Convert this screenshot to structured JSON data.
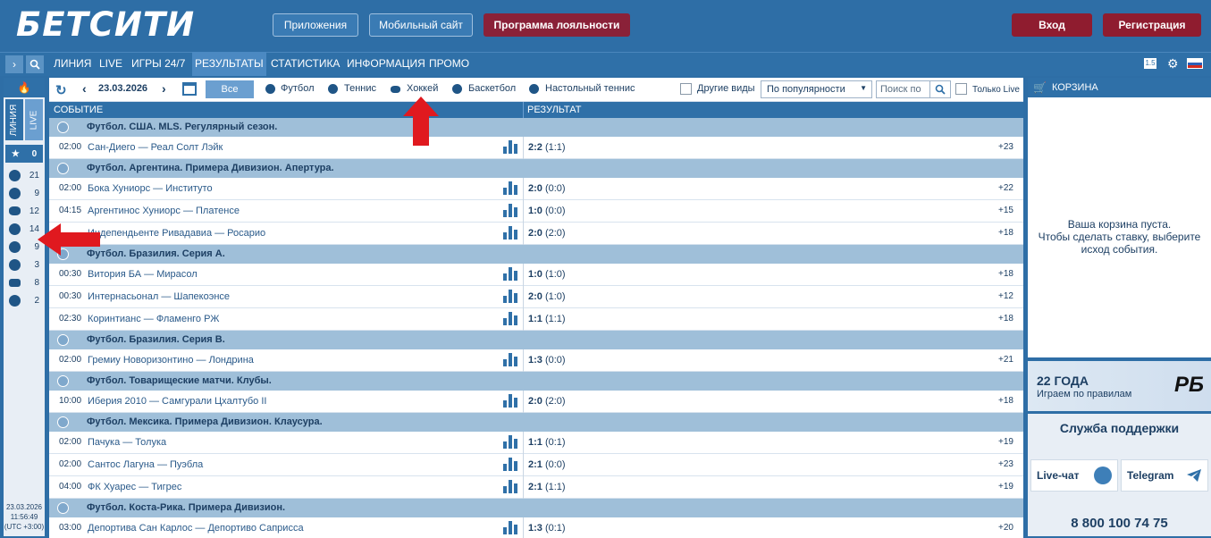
{
  "header": {
    "logo": "БЕТСИТИ",
    "apps_label": "Приложения",
    "mobile_label": "Мобильный сайт",
    "loyalty_label": "Программа лояльности",
    "login_label": "Вход",
    "register_label": "Регистрация"
  },
  "nav": {
    "items": [
      "ЛИНИЯ",
      "LIVE",
      "ИГРЫ 24/7",
      "РЕЗУЛЬТАТЫ",
      "СТАТИСТИКА",
      "ИНФОРМАЦИЯ",
      "ПРОМО"
    ],
    "badge": "1.5"
  },
  "sidebar": {
    "tabs": [
      "ЛИНИЯ",
      "LIVE"
    ],
    "favorites_count": "0",
    "sports": [
      {
        "icon": "soccer-ball-icon",
        "count": "21"
      },
      {
        "icon": "tennis-ball-icon",
        "count": "9"
      },
      {
        "icon": "hockey-puck-icon",
        "count": "12"
      },
      {
        "icon": "basketball-icon",
        "count": "14"
      },
      {
        "icon": "table-tennis-icon",
        "count": "9"
      },
      {
        "icon": "volleyball-icon",
        "count": "3"
      },
      {
        "icon": "gamepad-icon",
        "count": "8"
      },
      {
        "icon": "ball-icon",
        "count": "2"
      }
    ],
    "date": "23.03.2026",
    "time": "11:56:49",
    "tz": "(UTC +3:00)"
  },
  "toolbar": {
    "date": "23.03.2026",
    "all_label": "Все",
    "filters": [
      "Футбол",
      "Теннис",
      "Хоккей",
      "Баскетбол",
      "Настольный теннис"
    ],
    "other_label": "Другие виды",
    "sort_value": "По популярности",
    "search_placeholder": "Поиск по",
    "live_only_label": "Только Live"
  },
  "columns": {
    "event": "СОБЫТИЕ",
    "result": "РЕЗУЛЬТАТ"
  },
  "leagues": [
    {
      "name": "Футбол. США. MLS. Регулярный сезон.",
      "matches": [
        {
          "time": "02:00",
          "teams": "Сан-Диего — Реал Солт Лэйк",
          "score": "2:2",
          "half": "(1:1)",
          "more": "+23"
        }
      ]
    },
    {
      "name": "Футбол. Аргентина. Примера Дивизион. Апертура.",
      "matches": [
        {
          "time": "02:00",
          "teams": "Бока Хуниорс — Институто",
          "score": "2:0",
          "half": "(0:0)",
          "more": "+22"
        },
        {
          "time": "04:15",
          "teams": "Аргентинос Хуниорс — Платенсе",
          "score": "1:0",
          "half": "(0:0)",
          "more": "+15"
        },
        {
          "time": "",
          "teams": "Индепендьенте Ривадавиа — Росарио",
          "score": "2:0",
          "half": "(2:0)",
          "more": "+18"
        }
      ]
    },
    {
      "name": "Футбол. Бразилия. Серия А.",
      "matches": [
        {
          "time": "00:30",
          "teams": "Витория БА — Мирасол",
          "score": "1:0",
          "half": "(1:0)",
          "more": "+18"
        },
        {
          "time": "00:30",
          "teams": "Интернасьонал — Шапекоэнсе",
          "score": "2:0",
          "half": "(1:0)",
          "more": "+12"
        },
        {
          "time": "02:30",
          "teams": "Коринтианс — Фламенго РЖ",
          "score": "1:1",
          "half": "(1:1)",
          "more": "+18"
        }
      ]
    },
    {
      "name": "Футбол. Бразилия. Серия В.",
      "matches": [
        {
          "time": "02:00",
          "teams": "Гремиу Новоризонтино — Лондрина",
          "score": "1:3",
          "half": "(0:0)",
          "more": "+21"
        }
      ]
    },
    {
      "name": "Футбол. Товарищеские матчи. Клубы.",
      "matches": [
        {
          "time": "10:00",
          "teams": "Иберия 2010 — Самгурали Цхалтубо II",
          "score": "2:0",
          "half": "(2:0)",
          "more": "+18"
        }
      ]
    },
    {
      "name": "Футбол. Мексика. Примера Дивизион. Клаусура.",
      "matches": [
        {
          "time": "02:00",
          "teams": "Пачука — Толука",
          "score": "1:1",
          "half": "(0:1)",
          "more": "+19"
        },
        {
          "time": "02:00",
          "teams": "Сантос Лагуна — Пуэбла",
          "score": "2:1",
          "half": "(0:0)",
          "more": "+23"
        },
        {
          "time": "04:00",
          "teams": "ФК Хуарес — Тигрес",
          "score": "2:1",
          "half": "(1:1)",
          "more": "+19"
        }
      ]
    },
    {
      "name": "Футбол. Коста-Рика. Примера Дивизион.",
      "matches": [
        {
          "time": "03:00",
          "teams": "Депортива Сан Карлос — Депортиво Саприсса",
          "score": "1:3",
          "half": "(0:1)",
          "more": "+20"
        }
      ]
    }
  ],
  "cart": {
    "title": "КОРЗИНА",
    "empty_line1": "Ваша корзина пуста.",
    "empty_line2": "Чтобы сделать ставку, выберите",
    "empty_line3": "исход события."
  },
  "banner": {
    "title": "22 ГОДА",
    "subtitle": "Играем по правилам",
    "logo": "РБ"
  },
  "support": {
    "title": "Служба поддержки",
    "livechat": "Live-чат",
    "telegram": "Telegram",
    "phone": "8 800 100 74 75"
  },
  "colors": {
    "brand_blue": "#2f70a8",
    "header_blue": "#2e6ea6",
    "accent_red": "#8f1c2f",
    "arrow_red": "#e0191f"
  }
}
